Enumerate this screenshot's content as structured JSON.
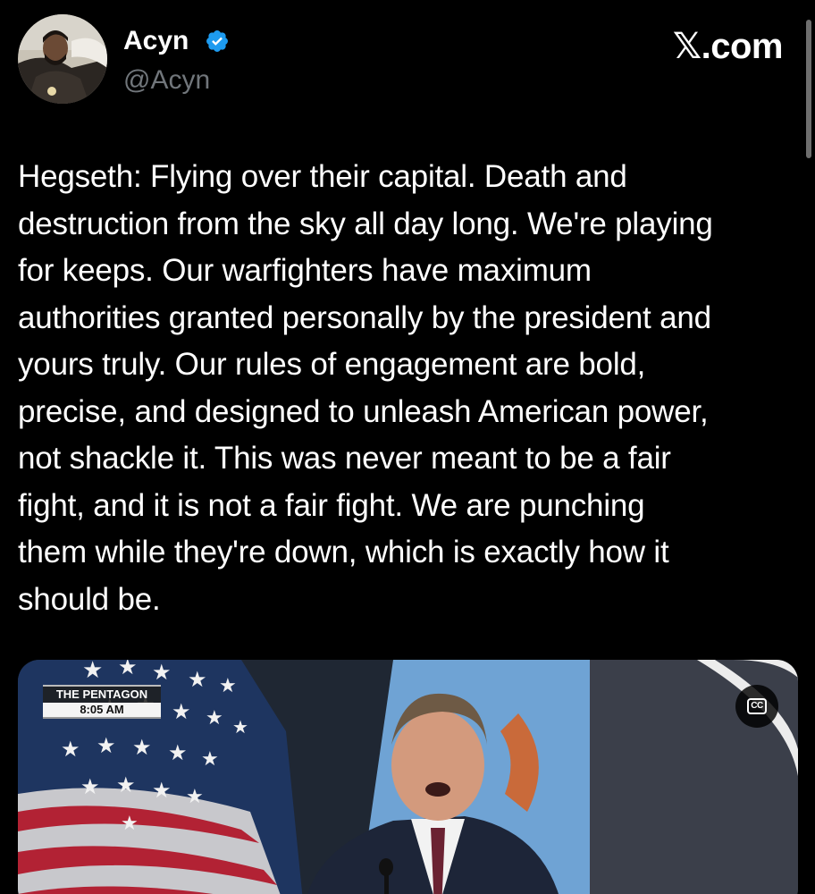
{
  "author": {
    "display_name": "Acyn",
    "handle": "@Acyn",
    "verified": true,
    "verified_icon": "verified-badge-icon"
  },
  "brand": {
    "x_glyph": "𝕏",
    "suffix": ".com"
  },
  "tweet": {
    "text": "Hegseth: Flying over their capital. Death and\ndestruction from the sky all day long. We're playing\nfor keeps. Our warfighters have maximum\nauthorities granted personally by the president and\nyours truly. Our rules of engagement are bold,\nprecise, and designed to unleash American power,\nnot shackle it. This was never meant to be a fair\nfight, and it is not a fair fight. We are punching\nthem while they're down, which is exactly how it\nshould be."
  },
  "media": {
    "lower_third_title": "THE PENTAGON",
    "lower_third_time": "8:05 AM",
    "cc_label": "CC",
    "cc_icon": "closed-captions-icon"
  },
  "colors": {
    "background": "#000000",
    "text": "#ffffff",
    "muted": "#71767b",
    "verified": "#1d9bf0"
  }
}
